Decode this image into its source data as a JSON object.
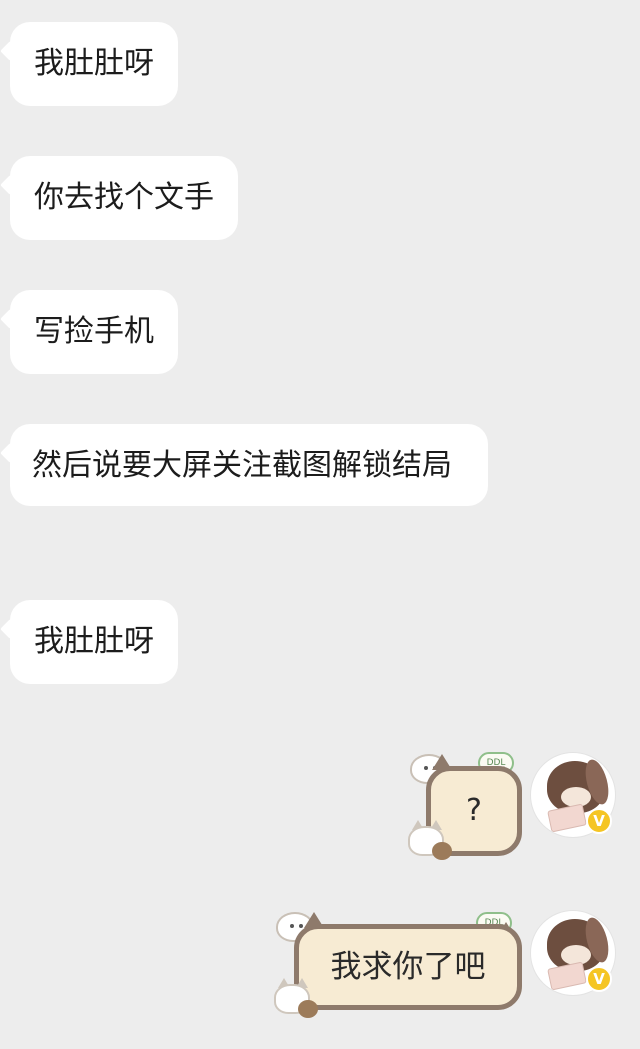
{
  "messages_in": [
    {
      "text": "我肚肚呀"
    },
    {
      "text": "你去找个文手"
    },
    {
      "text": "写捡手机"
    },
    {
      "text": "然后说要大屏关注截图解锁结局"
    },
    {
      "text": "我肚肚呀"
    }
  ],
  "messages_out": [
    {
      "text": "?",
      "bubble_tag": "DDL",
      "verified_badge": "V"
    },
    {
      "text": "我求你了吧",
      "bubble_tag": "DDL",
      "verified_badge": "V"
    }
  ],
  "colors": {
    "background": "#ededed",
    "incoming_bubble": "#ffffff",
    "outgoing_bubble_fill": "#f7ebd3",
    "outgoing_bubble_border": "#8e7a6b",
    "badge": "#f5c524"
  },
  "icons": {
    "bubble_decoration": "cat-ghost-sticker-icon",
    "avatar": "brown-bunny-avatar",
    "badge": "verified-v-badge-icon"
  }
}
